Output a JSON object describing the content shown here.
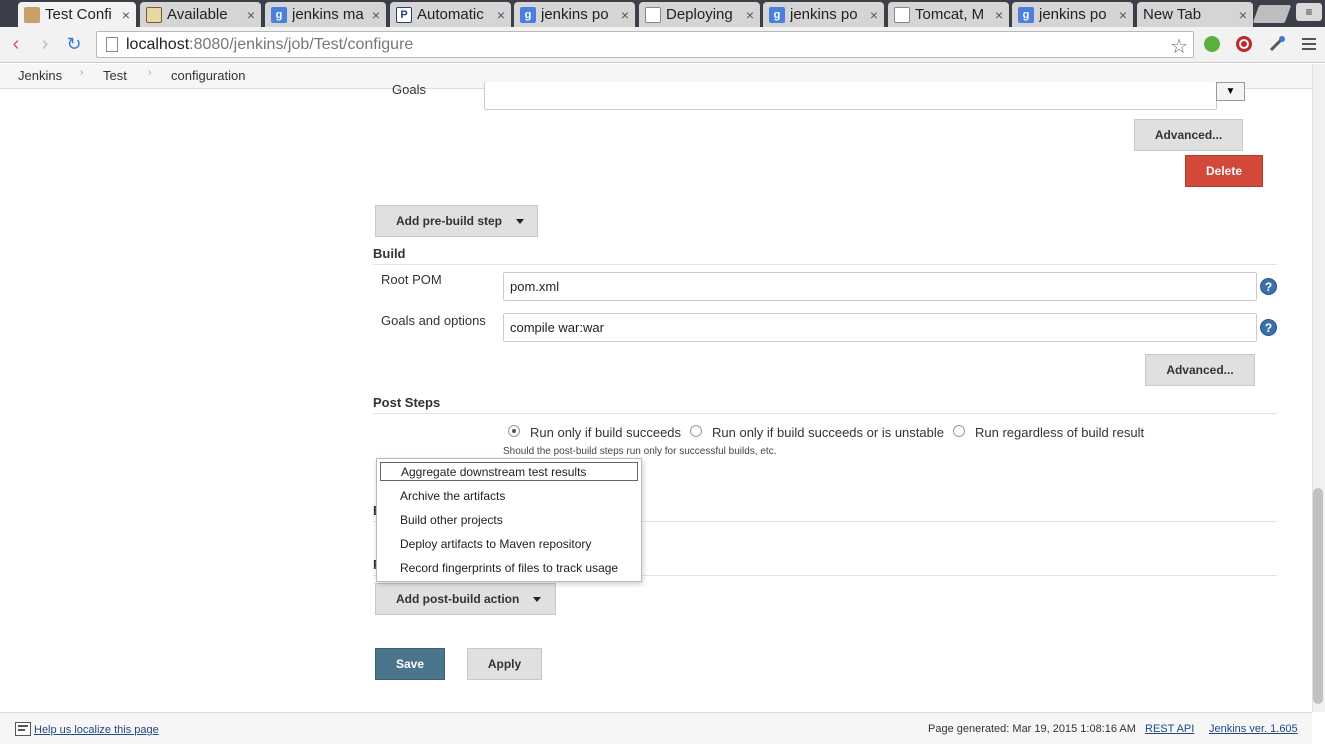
{
  "browser": {
    "tabs": [
      {
        "label": "Test Confi",
        "icon": "jenkins-icon",
        "active": true
      },
      {
        "label": "Available",
        "icon": "image-icon"
      },
      {
        "label": "jenkins ma",
        "icon": "google-icon"
      },
      {
        "label": "Automatic",
        "icon": "p-icon"
      },
      {
        "label": "jenkins po",
        "icon": "google-icon"
      },
      {
        "label": "Deploying",
        "icon": "document-icon"
      },
      {
        "label": "jenkins po",
        "icon": "google-icon"
      },
      {
        "label": "Tomcat, M",
        "icon": "document-icon"
      },
      {
        "label": "jenkins po",
        "icon": "google-icon"
      },
      {
        "label": "New Tab",
        "icon": ""
      }
    ],
    "close_glyph": "×",
    "url_host": "localhost",
    "url_rest": ":8080/jenkins/job/Test/configure"
  },
  "breadcrumb": {
    "items": [
      "Jenkins",
      "Test",
      "configuration"
    ],
    "separator": "›"
  },
  "pre_steps": {
    "goals_label": "Goals",
    "goals_value": "",
    "dropdown_glyph": "▼",
    "advanced_label": "Advanced...",
    "delete_label": "Delete",
    "add_pre_build_label": "Add pre-build step"
  },
  "build": {
    "title": "Build",
    "root_pom_label": "Root POM",
    "root_pom_value": "pom.xml",
    "goals_options_label": "Goals and options",
    "goals_options_value": "compile war:war",
    "help_glyph": "?",
    "advanced_label": "Advanced..."
  },
  "post_steps": {
    "title": "Post Steps",
    "options": [
      {
        "label": "Run only if build succeeds",
        "checked": true
      },
      {
        "label": "Run only if build succeeds or is unstable",
        "checked": false
      },
      {
        "label": "Run regardless of build result",
        "checked": false
      }
    ],
    "hint": "Should the post-build steps run only for successful builds, etc."
  },
  "post_build_menu": {
    "items": [
      "Aggregate downstream test results",
      "Archive the artifacts",
      "Build other projects",
      "Deploy artifacts to Maven repository",
      "Record fingerprints of files to track usage"
    ],
    "focused_index": 0
  },
  "actions": {
    "add_post_build_label": "Add post-build action",
    "save_label": "Save",
    "apply_label": "Apply"
  },
  "footer": {
    "localize_link": "Help us localize this page",
    "generated": "Page generated: Mar 19, 2015 1:08:16 AM",
    "rest_api": "REST API",
    "version": "Jenkins ver. 1.605"
  },
  "colors": {
    "delete_red": "#d24939",
    "save_blue": "#4b758b",
    "help_blue": "#3d6fa8"
  }
}
